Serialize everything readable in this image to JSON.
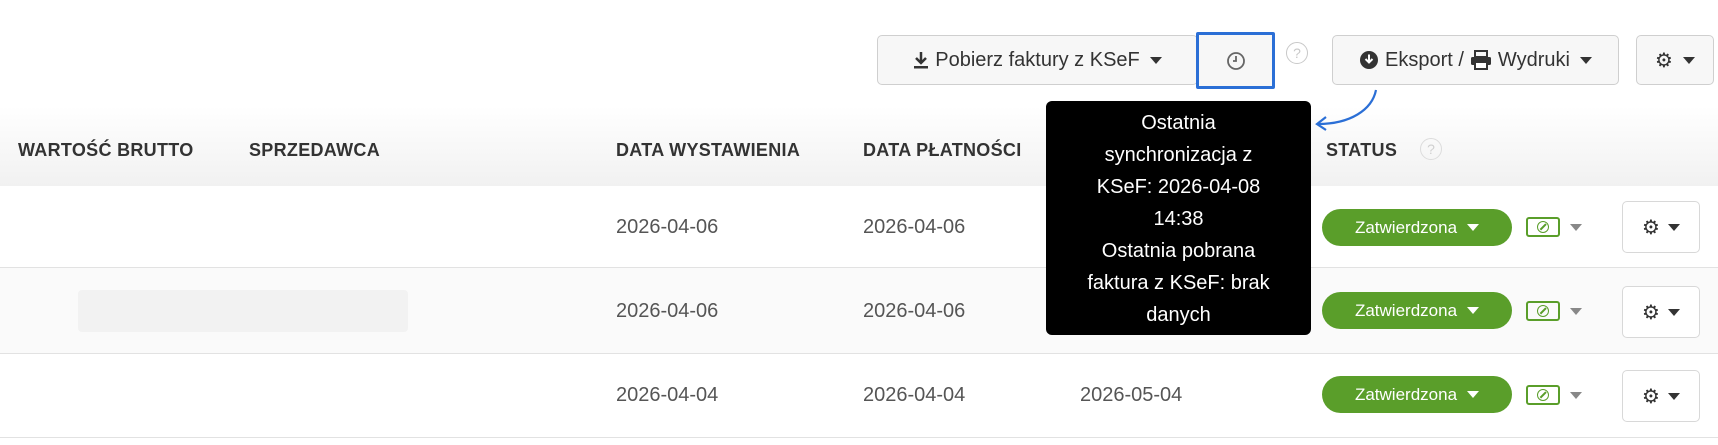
{
  "toolbar": {
    "download_label": "Pobierz faktury z KSeF",
    "export_label": "Eksport / ",
    "prints_label": "Wydruki",
    "help_mark": "?"
  },
  "icons": {
    "download": "download-icon",
    "sync": "clock-icon",
    "export": "circle-download-icon",
    "print": "printer-icon",
    "settings": "gear-icon"
  },
  "table": {
    "headers": {
      "gross_value": "WARTOŚĆ BRUTTO",
      "seller": "SPRZEDAWCA",
      "issue_date": "DATA WYSTAWIENIA",
      "payment_date": "DATA PŁATNOŚCI",
      "status": "STATUS"
    },
    "rows": [
      {
        "issue_date": "2026-04-06",
        "payment_date": "2026-04-06",
        "due_date": "",
        "status": "Zatwierdzona"
      },
      {
        "issue_date": "2026-04-06",
        "payment_date": "2026-04-06",
        "due_date": "",
        "status": "Zatwierdzona"
      },
      {
        "issue_date": "2026-04-04",
        "payment_date": "2026-04-04",
        "due_date": "2026-05-04",
        "status": "Zatwierdzona"
      }
    ]
  },
  "tooltip": {
    "lines": [
      "Ostatnia",
      "synchronizacja z",
      "KSeF: 2026-04-08",
      "14:38",
      "Ostatnia pobrana",
      "faktura z KSeF: brak",
      "danych"
    ]
  },
  "colors": {
    "status_green": "#5a9e2a",
    "highlight_blue": "#2b6fd6",
    "tooltip_bg": "#000000"
  }
}
